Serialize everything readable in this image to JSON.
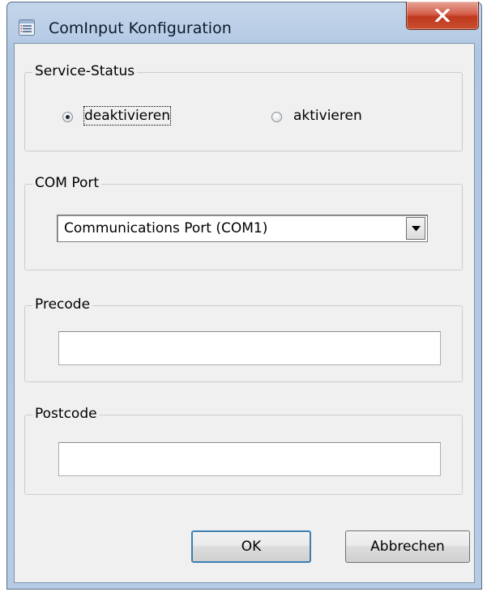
{
  "window": {
    "title": "ComInput Konfiguration",
    "close_symbol": "X"
  },
  "service_status": {
    "legend": "Service-Status",
    "options": [
      {
        "label": "deaktivieren",
        "selected": true
      },
      {
        "label": "aktivieren",
        "selected": false
      }
    ]
  },
  "com_port": {
    "legend": "COM Port",
    "selected": "Communications Port (COM1)"
  },
  "precode": {
    "legend": "Precode",
    "value": ""
  },
  "postcode": {
    "legend": "Postcode",
    "value": ""
  },
  "buttons": {
    "ok": "OK",
    "cancel": "Abbrechen"
  },
  "icons": {
    "app": "list-window-icon",
    "close": "close-icon",
    "dropdown": "chevron-down-icon"
  },
  "colors": {
    "frame": "#b8cde6",
    "client": "#f0f0f0",
    "close_button": "#c74f2e",
    "default_button_border": "#3c7fb1"
  }
}
